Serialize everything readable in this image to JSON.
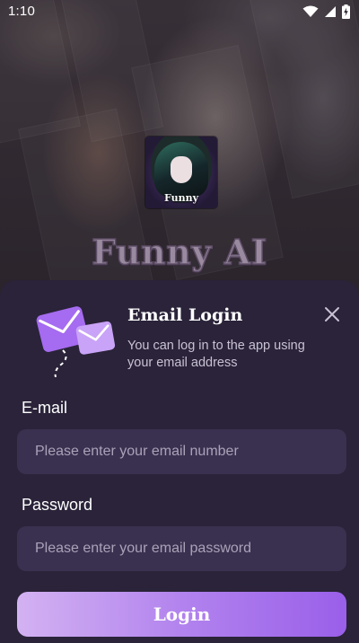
{
  "status_bar": {
    "time": "1:10",
    "icons": [
      "wifi-icon",
      "signal-icon",
      "battery-charging-icon"
    ]
  },
  "app": {
    "logo_text": "Funny",
    "title": "Funny AI"
  },
  "login_sheet": {
    "title": "Email Login",
    "subtitle": "You can log in to the app using your email address",
    "email": {
      "label": "E-mail",
      "placeholder": "Please enter your email number",
      "value": ""
    },
    "password": {
      "label": "Password",
      "placeholder": "Please enter your email password",
      "value": ""
    },
    "login_label": "Login",
    "close_icon": "close-icon",
    "illustration_icon": "envelopes-icon"
  },
  "colors": {
    "sheet_background": "#2a2339",
    "input_background": "#3a3150",
    "accent_start": "#d3b2f2",
    "accent_end": "#9a5fe9",
    "envelope": "#a56bf0"
  }
}
